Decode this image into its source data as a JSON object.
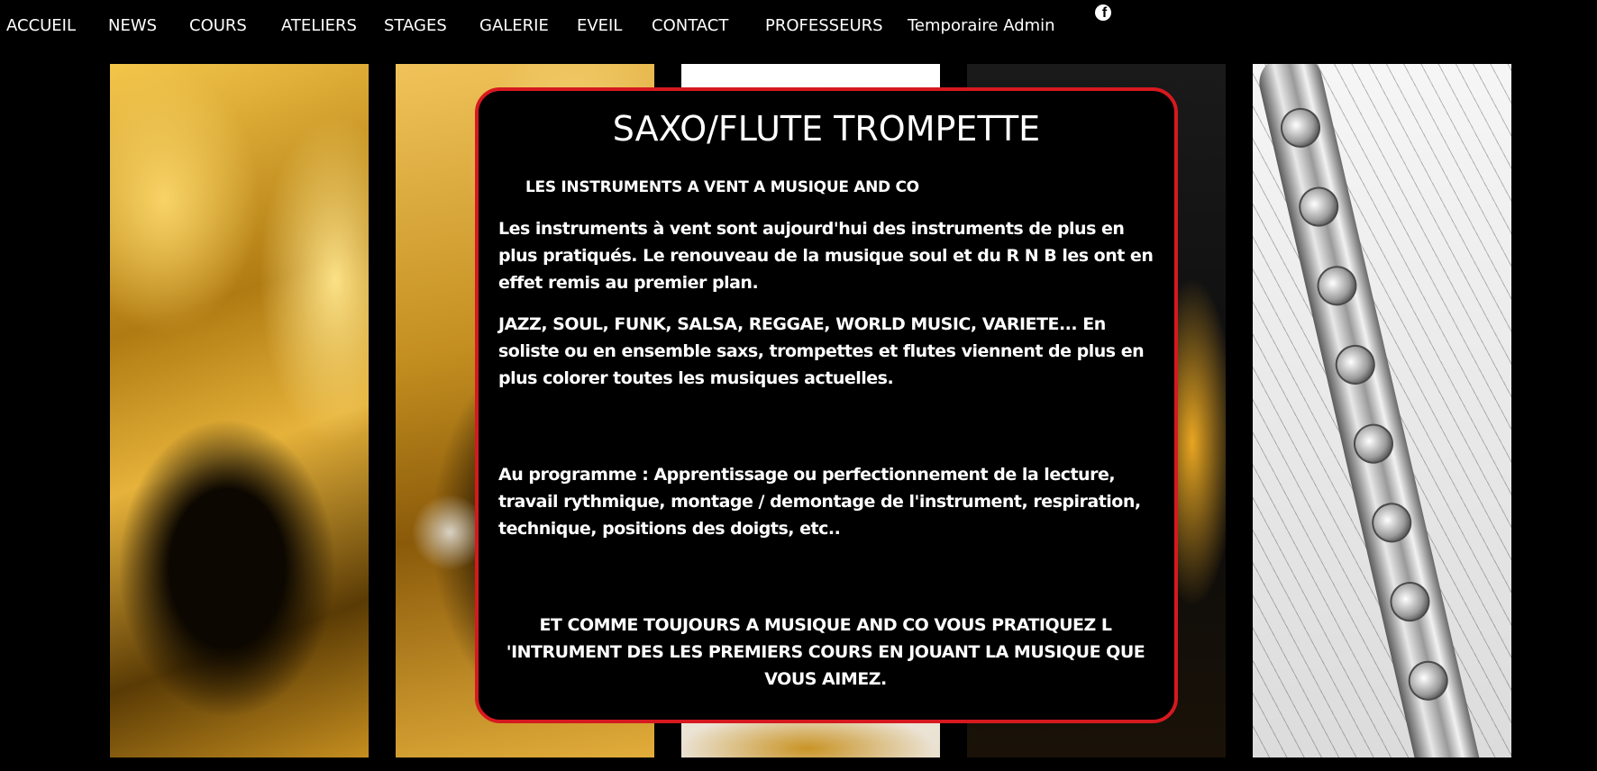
{
  "nav": {
    "items": [
      {
        "label": "ACCUEIL"
      },
      {
        "label": "NEWS"
      },
      {
        "label": "COURS"
      },
      {
        "label": "ATELIERS"
      },
      {
        "label": "STAGES"
      },
      {
        "label": "GALERIE"
      },
      {
        "label": "EVEIL"
      },
      {
        "label": "CONTACT"
      },
      {
        "label": "PROFESSEURS"
      },
      {
        "label": "Temporaire Admin"
      }
    ],
    "social_icon": "facebook-icon",
    "social_glyph": "f"
  },
  "gallery": {
    "images": [
      "saxophone-photo",
      "saxophone-closeup-photo",
      "trumpet-photo",
      "horn-photo",
      "flute-sheet-music-photo"
    ]
  },
  "card": {
    "title": "SAXO/FLUTE TROMPETTE",
    "subtitle": "LES INSTRUMENTS A VENT A MUSIQUE AND CO",
    "paragraphs": [
      "Les instruments à vent sont aujourd'hui des instruments de plus en plus pratiqués. Le renouveau de la musique soul et du R N B les ont en effet remis au premier plan.",
      "JAZZ, SOUL, FUNK, SALSA,  REGGAE,  WORLD MUSIC, VARIETE... En soliste ou en ensemble  saxs,  trompettes et flutes viennent de plus en plus colorer toutes les musiques actuelles.",
      "Au programme : Apprentissage ou perfectionnement de la lecture, travail rythmique, montage / demontage de l'instrument, respiration, technique,  positions des doigts,  etc..",
      "ET COMME TOUJOURS A MUSIQUE AND CO VOUS PRATIQUEZ L 'INTRUMENT DES LES PREMIERS COURS EN JOUANT  LA MUSIQUE QUE VOUS AIMEZ."
    ]
  },
  "colors": {
    "background": "#000000",
    "text": "#ffffff",
    "card_border": "#d6191f"
  }
}
